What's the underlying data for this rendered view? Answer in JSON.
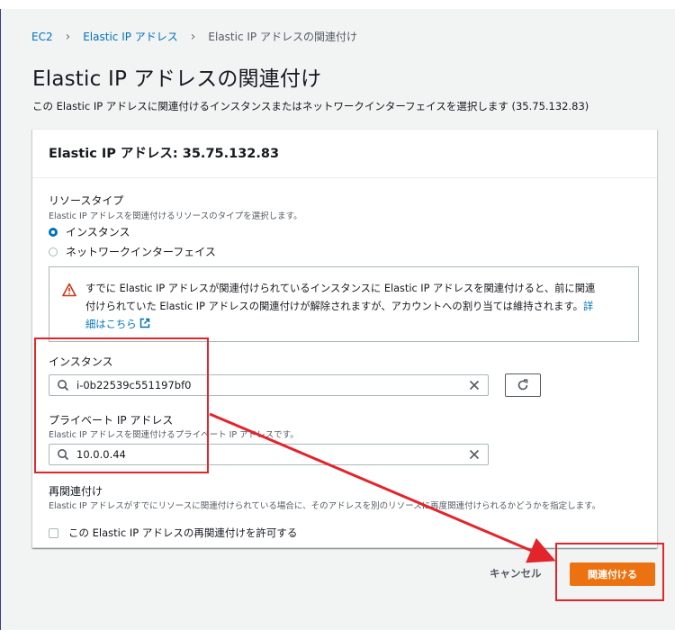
{
  "breadcrumb": {
    "items": [
      "EC2",
      "Elastic IP アドレス",
      "Elastic IP アドレスの関連付け"
    ]
  },
  "page": {
    "title": "Elastic IP アドレスの関連付け",
    "description": "この Elastic IP アドレスに関連付けるインスタンスまたはネットワークインターフェイスを選択します (35.75.132.83)"
  },
  "container": {
    "title": "Elastic IP アドレス: 35.75.132.83"
  },
  "resource_type": {
    "label": "リソースタイプ",
    "description": "Elastic IP アドレスを関連付けるリソースのタイプを選択します。",
    "options": [
      "インスタンス",
      "ネットワークインターフェイス"
    ],
    "selected": "インスタンス"
  },
  "alert": {
    "line1": "すでに Elastic IP アドレスが関連付けられているインスタンスに Elastic IP アドレスを関連付けると、前に関連",
    "line2_text": "付けられていた Elastic IP アドレスの関連付けが解除されますが、アカウントへの割り当ては維持されます。",
    "link_part1": "詳",
    "link_part2": "細はこちら"
  },
  "instance": {
    "label": "インスタンス",
    "value": "i-0b22539c551197bf0"
  },
  "private_ip": {
    "label": "プライベート IP アドレス",
    "description": "Elastic IP アドレスを関連付けるプライベート IP アドレスです。",
    "value": "10.0.0.44"
  },
  "reassociation": {
    "label": "再関連付け",
    "description": "Elastic IP アドレスがすでにリソースに関連付けられている場合に、そのアドレスを別のリソースに再度関連付けられるかどうかを指定します。",
    "checkbox_label": "この Elastic IP アドレスの再関連付けを許可する"
  },
  "actions": {
    "cancel": "キャンセル",
    "associate": "関連付ける"
  },
  "colors": {
    "link": "#0073bb",
    "primary": "#ec7211",
    "annotation": "#e3242b",
    "warning": "#d13212"
  }
}
